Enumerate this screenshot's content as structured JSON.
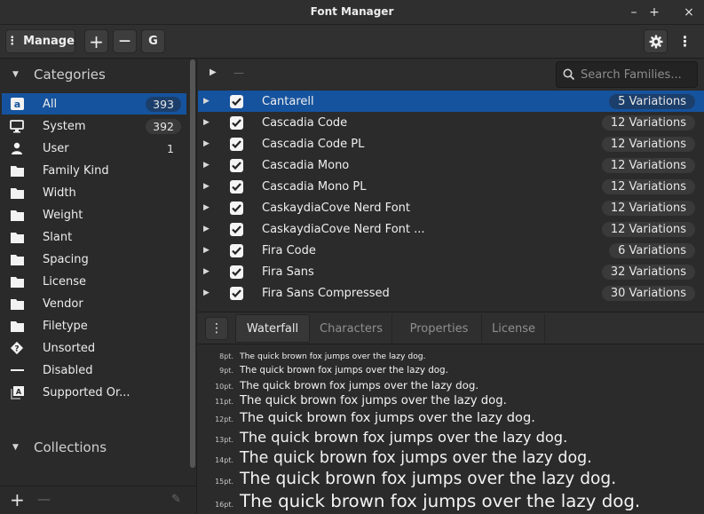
{
  "window": {
    "title": "Font Manager",
    "controls": {
      "minimize": "–",
      "maximize": "+",
      "close": "×"
    }
  },
  "header": {
    "manage_label": "Manage",
    "add_label": "+",
    "remove_label": "—",
    "google_label": "G"
  },
  "sidebar": {
    "categories_title": "Categories",
    "collections_title": "Collections",
    "items": [
      {
        "label": "All",
        "count": "393",
        "icon": "font-a-icon",
        "selected": true
      },
      {
        "label": "System",
        "count": "392",
        "icon": "monitor-icon"
      },
      {
        "label": "User",
        "count": "1",
        "icon": "user-icon"
      },
      {
        "label": "Family Kind",
        "icon": "folder-icon"
      },
      {
        "label": "Width",
        "icon": "folder-icon"
      },
      {
        "label": "Weight",
        "icon": "folder-icon"
      },
      {
        "label": "Slant",
        "icon": "folder-icon"
      },
      {
        "label": "Spacing",
        "icon": "folder-icon"
      },
      {
        "label": "License",
        "icon": "folder-icon"
      },
      {
        "label": "Vendor",
        "icon": "folder-icon"
      },
      {
        "label": "Filetype",
        "icon": "folder-icon"
      },
      {
        "label": "Unsorted",
        "icon": "question-diamond-icon"
      },
      {
        "label": "Disabled",
        "icon": "dash-icon"
      },
      {
        "label": "Supported Or...",
        "icon": "orthography-icon"
      }
    ]
  },
  "families": {
    "search_placeholder": "Search Families...",
    "rows": [
      {
        "name": "Cantarell",
        "variations": "5 Variations",
        "selected": true
      },
      {
        "name": "Cascadia Code",
        "variations": "12 Variations"
      },
      {
        "name": "Cascadia Code PL",
        "variations": "12 Variations"
      },
      {
        "name": "Cascadia Mono",
        "variations": "12 Variations"
      },
      {
        "name": "Cascadia Mono PL",
        "variations": "12 Variations"
      },
      {
        "name": "CaskaydiaCove Nerd Font",
        "variations": "12 Variations"
      },
      {
        "name": "CaskaydiaCove Nerd Font ...",
        "variations": "12 Variations"
      },
      {
        "name": "Fira Code",
        "variations": "6 Variations"
      },
      {
        "name": "Fira Sans",
        "variations": "32 Variations"
      },
      {
        "name": "Fira Sans Compressed",
        "variations": "30 Variations"
      }
    ]
  },
  "preview": {
    "tabs": [
      "Waterfall",
      "Characters",
      "Properties",
      "License"
    ],
    "active_tab": "Waterfall",
    "sample": "The quick brown fox jumps over the lazy dog.",
    "sizes": [
      "8pt.",
      "9pt.",
      "10pt.",
      "11pt.",
      "12pt.",
      "13pt.",
      "14pt.",
      "15pt.",
      "16pt."
    ]
  },
  "colors": {
    "selection": "#15539e",
    "background": "#2b2b2b"
  }
}
